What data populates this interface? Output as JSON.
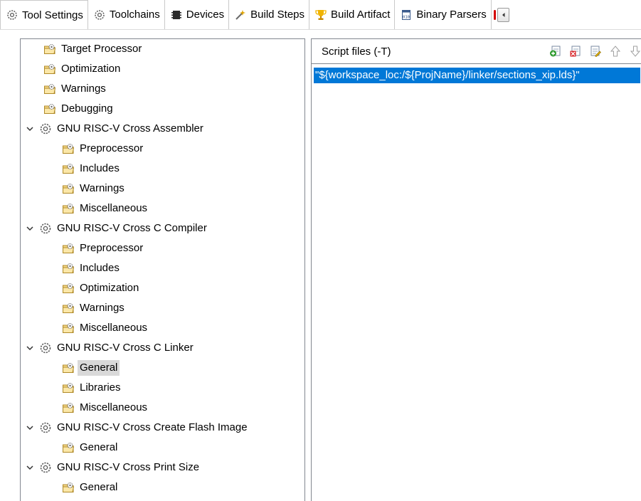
{
  "tabs": [
    {
      "label": "Tool Settings",
      "icon": "gear-icon",
      "active": true
    },
    {
      "label": "Toolchains",
      "icon": "gear-icon"
    },
    {
      "label": "Devices",
      "icon": "chip-icon"
    },
    {
      "label": "Build Steps",
      "icon": "wand-icon"
    },
    {
      "label": "Build Artifact",
      "icon": "trophy-icon"
    },
    {
      "label": "Binary Parsers",
      "icon": "binary-file-icon"
    }
  ],
  "tree": {
    "items": [
      {
        "label": "Target Processor",
        "type": "option",
        "level": 1
      },
      {
        "label": "Optimization",
        "type": "option",
        "level": 1
      },
      {
        "label": "Warnings",
        "type": "option",
        "level": 1
      },
      {
        "label": "Debugging",
        "type": "option",
        "level": 1
      },
      {
        "label": "GNU RISC-V Cross Assembler",
        "type": "tool",
        "level": 0,
        "expanded": true
      },
      {
        "label": "Preprocessor",
        "type": "option",
        "level": 2
      },
      {
        "label": "Includes",
        "type": "option",
        "level": 2
      },
      {
        "label": "Warnings",
        "type": "option",
        "level": 2
      },
      {
        "label": "Miscellaneous",
        "type": "option",
        "level": 2
      },
      {
        "label": "GNU RISC-V Cross C Compiler",
        "type": "tool",
        "level": 0,
        "expanded": true
      },
      {
        "label": "Preprocessor",
        "type": "option",
        "level": 2
      },
      {
        "label": "Includes",
        "type": "option",
        "level": 2
      },
      {
        "label": "Optimization",
        "type": "option",
        "level": 2
      },
      {
        "label": "Warnings",
        "type": "option",
        "level": 2
      },
      {
        "label": "Miscellaneous",
        "type": "option",
        "level": 2
      },
      {
        "label": "GNU RISC-V Cross C Linker",
        "type": "tool",
        "level": 0,
        "expanded": true
      },
      {
        "label": "General",
        "type": "option",
        "level": 2,
        "selected": true
      },
      {
        "label": "Libraries",
        "type": "option",
        "level": 2
      },
      {
        "label": "Miscellaneous",
        "type": "option",
        "level": 2
      },
      {
        "label": "GNU RISC-V Cross Create Flash Image",
        "type": "tool",
        "level": 0,
        "expanded": true
      },
      {
        "label": "General",
        "type": "option",
        "level": 2
      },
      {
        "label": "GNU RISC-V Cross Print Size",
        "type": "tool",
        "level": 0,
        "expanded": true
      },
      {
        "label": "General",
        "type": "option",
        "level": 2
      }
    ]
  },
  "script_files": {
    "title": "Script files (-T)",
    "toolbar": [
      "add-icon",
      "delete-icon",
      "edit-icon",
      "move-up-icon",
      "move-down-icon"
    ],
    "items": [
      "\"${workspace_loc:/${ProjName}/linker/sections_xip.lds}\""
    ]
  },
  "colors": {
    "selection": "#0078d7",
    "tree_selection": "#d9d9d9",
    "border": "#828790"
  }
}
